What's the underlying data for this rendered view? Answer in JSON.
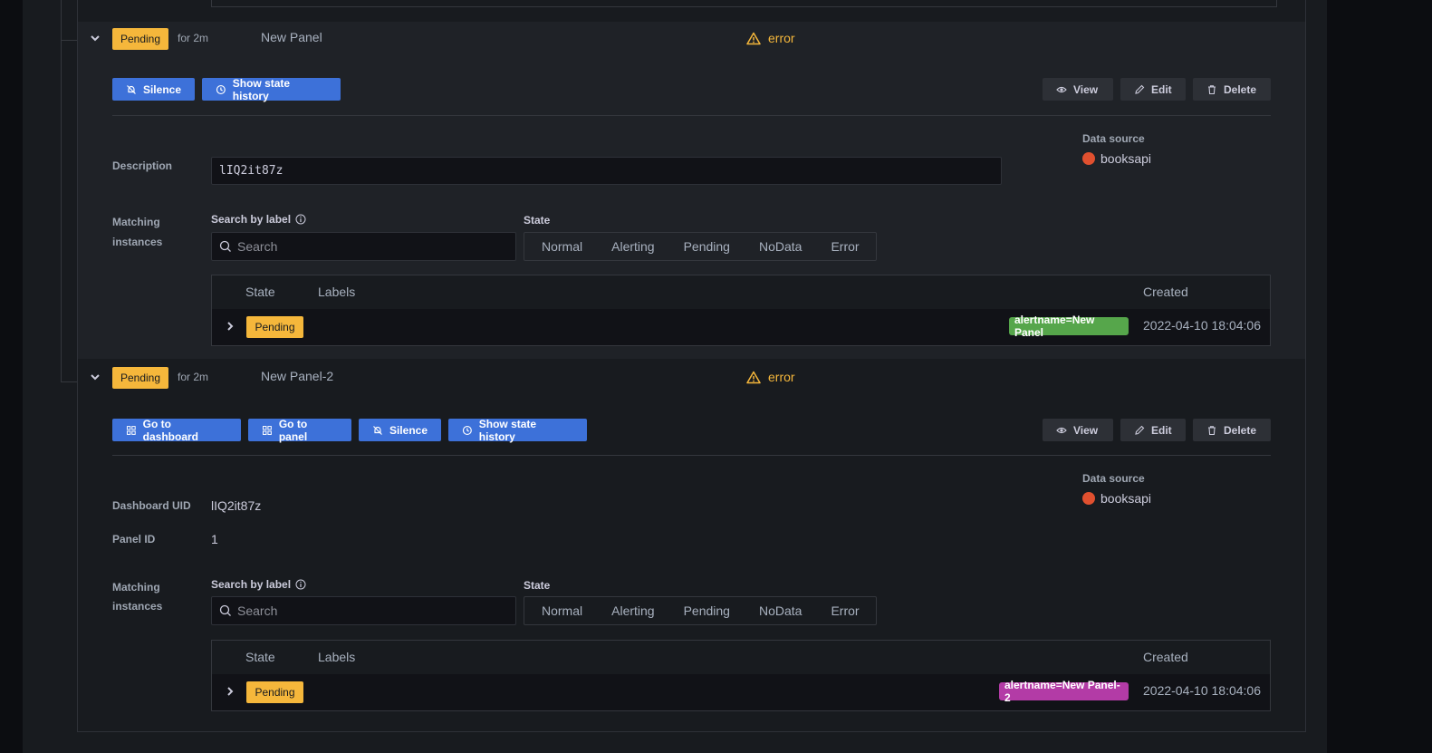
{
  "rules": [
    {
      "state": "Pending",
      "duration": "for 2m",
      "name": "New Panel",
      "health": "error",
      "actions_left": [
        "Silence",
        "Show state history"
      ],
      "actions_right": [
        "View",
        "Edit",
        "Delete"
      ],
      "data_source_label": "Data source",
      "data_source": "booksapi",
      "description_label": "Description",
      "description": "lIQ2it87z",
      "matching_label_1": "Matching",
      "matching_label_2": "instances",
      "search_label": "Search by label",
      "search_placeholder": "Search",
      "state_label": "State",
      "state_options": [
        "Normal",
        "Alerting",
        "Pending",
        "NoData",
        "Error"
      ],
      "table_headers": {
        "state": "State",
        "labels": "Labels",
        "created": "Created"
      },
      "instance": {
        "state": "Pending",
        "label": "alertname=New Panel",
        "label_color": "#56a64b",
        "created": "2022-04-10 18:04:06"
      }
    },
    {
      "state": "Pending",
      "duration": "for 2m",
      "name": "New Panel-2",
      "health": "error",
      "actions_left": [
        "Go to dashboard",
        "Go to panel",
        "Silence",
        "Show state history"
      ],
      "actions_right": [
        "View",
        "Edit",
        "Delete"
      ],
      "data_source_label": "Data source",
      "data_source": "booksapi",
      "dashboard_uid_label": "Dashboard UID",
      "dashboard_uid": "lIQ2it87z",
      "panel_id_label": "Panel ID",
      "panel_id": "1",
      "matching_label_1": "Matching",
      "matching_label_2": "instances",
      "search_label": "Search by label",
      "search_placeholder": "Search",
      "state_label": "State",
      "state_options": [
        "Normal",
        "Alerting",
        "Pending",
        "NoData",
        "Error"
      ],
      "table_headers": {
        "state": "State",
        "labels": "Labels",
        "created": "Created"
      },
      "instance": {
        "state": "Pending",
        "label": "alertname=New Panel-2",
        "label_color": "#b33ba6",
        "created": "2022-04-10 18:04:06"
      }
    }
  ],
  "colors": {
    "primary": "#3d71d9",
    "pending": "#f5b73b",
    "error": "#f5b73b"
  }
}
